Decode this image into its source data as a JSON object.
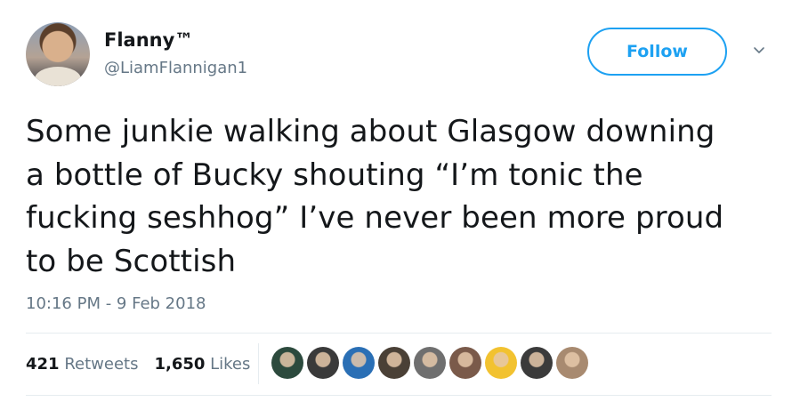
{
  "user": {
    "display_name": "Flanny™",
    "handle": "@LiamFlannigan1"
  },
  "follow_label": "Follow",
  "tweet": {
    "text": "Some junkie walking about Glasgow downing\na bottle of Bucky shouting “I’m tonic the\nfucking seshhog” I’ve never been more proud\nto be Scottish",
    "timestamp": "10:16 PM - 9 Feb 2018"
  },
  "stats": {
    "retweets_count": "421",
    "retweets_label": "Retweets",
    "likes_count": "1,650",
    "likes_label": "Likes"
  },
  "colors": {
    "accent": "#1da1f2",
    "secondary_text": "#657786",
    "primary_text": "#14171a"
  },
  "liker_avatars": [
    {
      "icon": "liker-avatar-1",
      "bg": "#2c4a3d"
    },
    {
      "icon": "liker-avatar-2",
      "bg": "#3a3a3a"
    },
    {
      "icon": "liker-avatar-3",
      "bg": "#2a6fb5"
    },
    {
      "icon": "liker-avatar-4",
      "bg": "#4a4036"
    },
    {
      "icon": "liker-avatar-5",
      "bg": "#6f6f6f"
    },
    {
      "icon": "liker-avatar-6",
      "bg": "#7a5a4a"
    },
    {
      "icon": "liker-avatar-7",
      "bg": "#f2c230"
    },
    {
      "icon": "liker-avatar-8",
      "bg": "#3b3b3b"
    },
    {
      "icon": "liker-avatar-9",
      "bg": "#a88a70"
    }
  ]
}
